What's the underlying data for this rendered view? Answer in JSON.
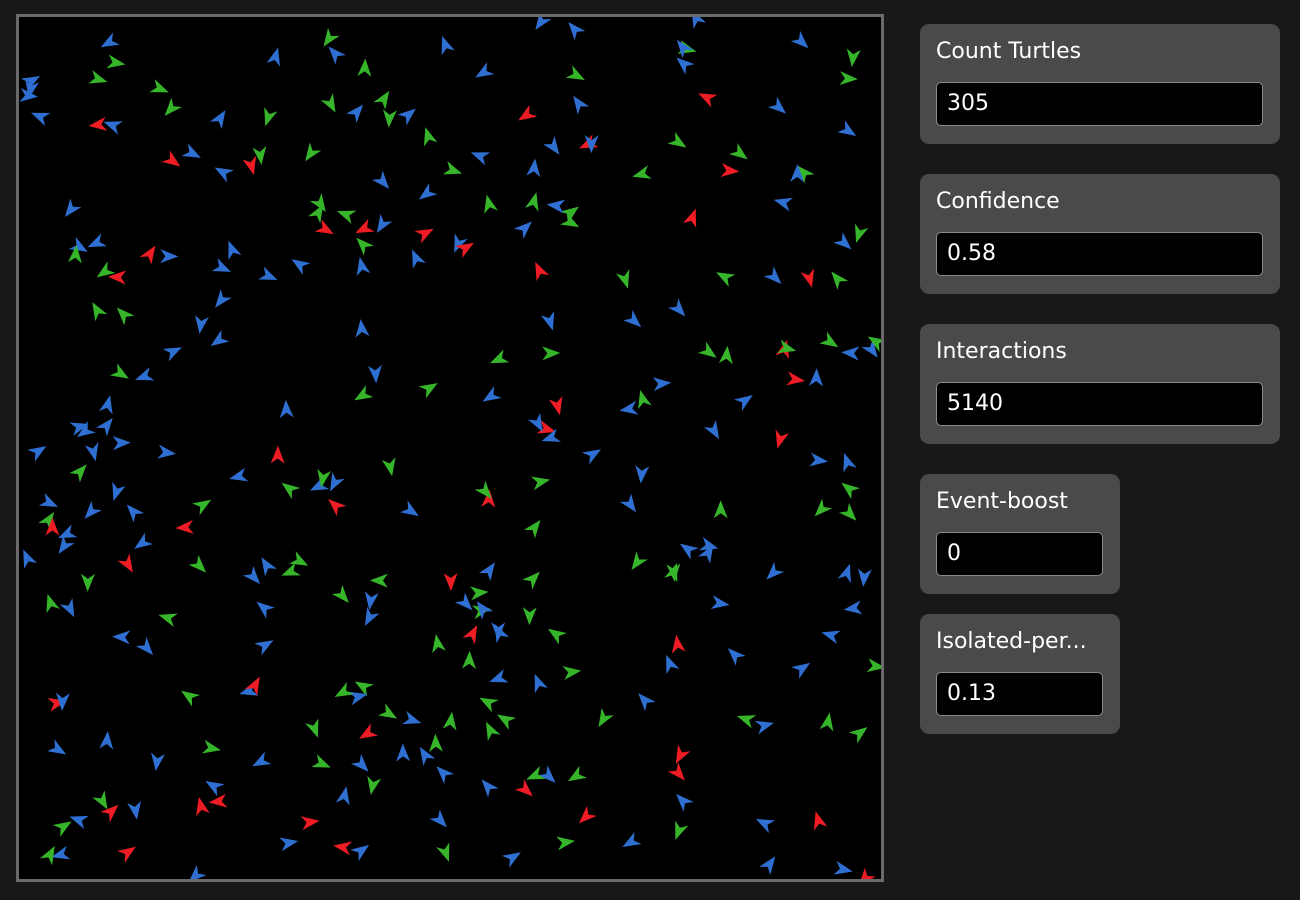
{
  "world": {
    "background": "#000000",
    "colors": {
      "blue": "#2e6fd1",
      "green": "#36b52b",
      "red": "#ee1c24"
    },
    "turtle_icon": "arrowhead-icon"
  },
  "monitors": {
    "count_turtles": {
      "label": "Count Turtles",
      "value": "305"
    },
    "confidence": {
      "label": "Confidence",
      "value": "0.58"
    },
    "interactions": {
      "label": "Interactions",
      "value": "5140"
    },
    "event_boost": {
      "label": "Event-boost",
      "value": "0"
    },
    "isolated": {
      "label": "Isolated-per...",
      "value": "0.13"
    }
  }
}
